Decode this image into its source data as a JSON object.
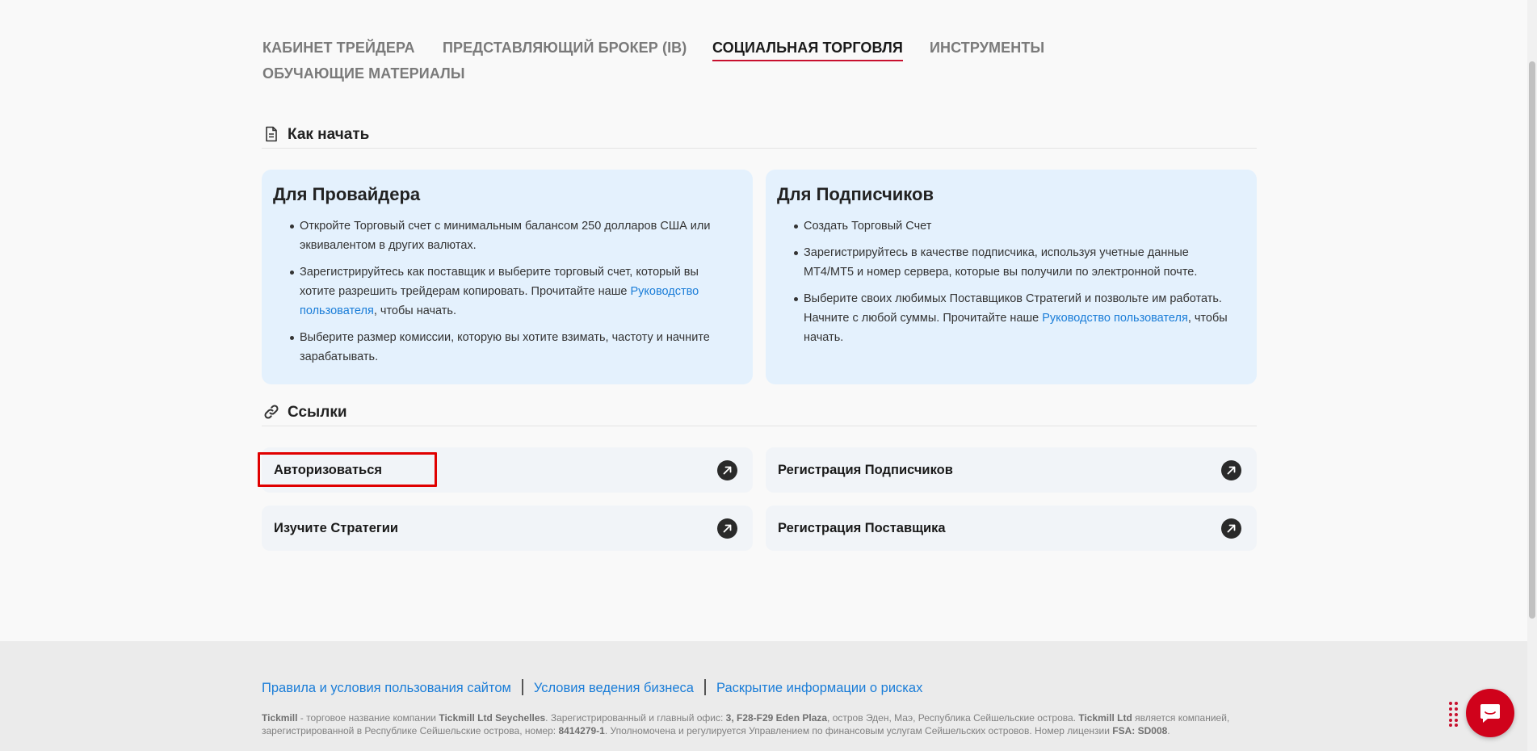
{
  "tabs": [
    {
      "label": "КАБИНЕТ ТРЕЙДЕРА",
      "active": false
    },
    {
      "label": "ПРЕДСТАВЛЯЮЩИЙ БРОКЕР (IB)",
      "active": false
    },
    {
      "label": "СОЦИАЛЬНАЯ ТОРГОВЛЯ",
      "active": true
    },
    {
      "label": "ИНСТРУМЕНТЫ",
      "active": false
    },
    {
      "label": "ОБУЧАЮЩИЕ МАТЕРИАЛЫ",
      "active": false
    }
  ],
  "how_to_start": {
    "icon": "document-icon",
    "title": "Как начать",
    "provider": {
      "heading": "Для Провайдера",
      "item1": "Откройте Торговый счет с минимальным балансом 250 долларов США или эквивалентом в других валютах.",
      "item2_before": "Зарегистрируйтесь как поставщик и выберите торговый счет, который вы хотите разрешить трейдерам копировать. Прочитайте наше ",
      "item2_link": "Руководство пользователя",
      "item2_after": ", чтобы начать.",
      "item3": "Выберите размер комиссии, которую вы хотите взимать, частоту и начните зарабатывать."
    },
    "subscriber": {
      "heading": "Для Подписчиков",
      "item1": "Создать Торговый Счет",
      "item2": "Зарегистрируйтесь в качестве подписчика, используя учетные данные MT4/MT5 и номер сервера, которые вы получили по электронной почте.",
      "item3_before": "Выберите своих любимых Поставщиков Стратегий и позвольте им работать. Начните с любой суммы. Прочитайте наше ",
      "item3_link": "Руководство пользователя",
      "item3_after": ", чтобы начать."
    }
  },
  "links": {
    "icon": "link-icon",
    "title": "Ссылки",
    "items": [
      {
        "label": "Авторизоваться",
        "icon": "arrow-up-right-icon"
      },
      {
        "label": "Регистрация Подписчиков",
        "icon": "arrow-up-right-icon"
      },
      {
        "label": "Изучите Стратегии",
        "icon": "arrow-up-right-icon"
      },
      {
        "label": "Регистрация Поставщика",
        "icon": "arrow-up-right-icon"
      }
    ]
  },
  "footer": {
    "links": [
      "Правила и условия пользования сайтом",
      "Условия ведения бизнеса",
      "Раскрытие информации о рисках"
    ],
    "legal": {
      "brand": "Tickmill",
      "t1": " - торговое название компании ",
      "company": "Tickmill Ltd Seychelles",
      "t2": ". Зарегистрированный и главный офис: ",
      "office": "3, F28-F29 Eden Plaza",
      "t3": ", остров Эден, Маэ, Республика Сейшельские острова. ",
      "company2": "Tickmill Ltd",
      "t4": " является компанией, зарегистрированной в Республике Сейшельские острова, номер: ",
      "regnum": "8414279-1",
      "t5": ". Уполномочена и регулируется Управлением по финансовым услугам Сейшельских островов. Номер лицензии ",
      "fsa": "FSA: SD008",
      "t6": "."
    }
  },
  "colors": {
    "accent": "#c8102e",
    "link": "#1a7dd8",
    "card_bg": "#e4f1fd",
    "chat": "#d0021b"
  }
}
